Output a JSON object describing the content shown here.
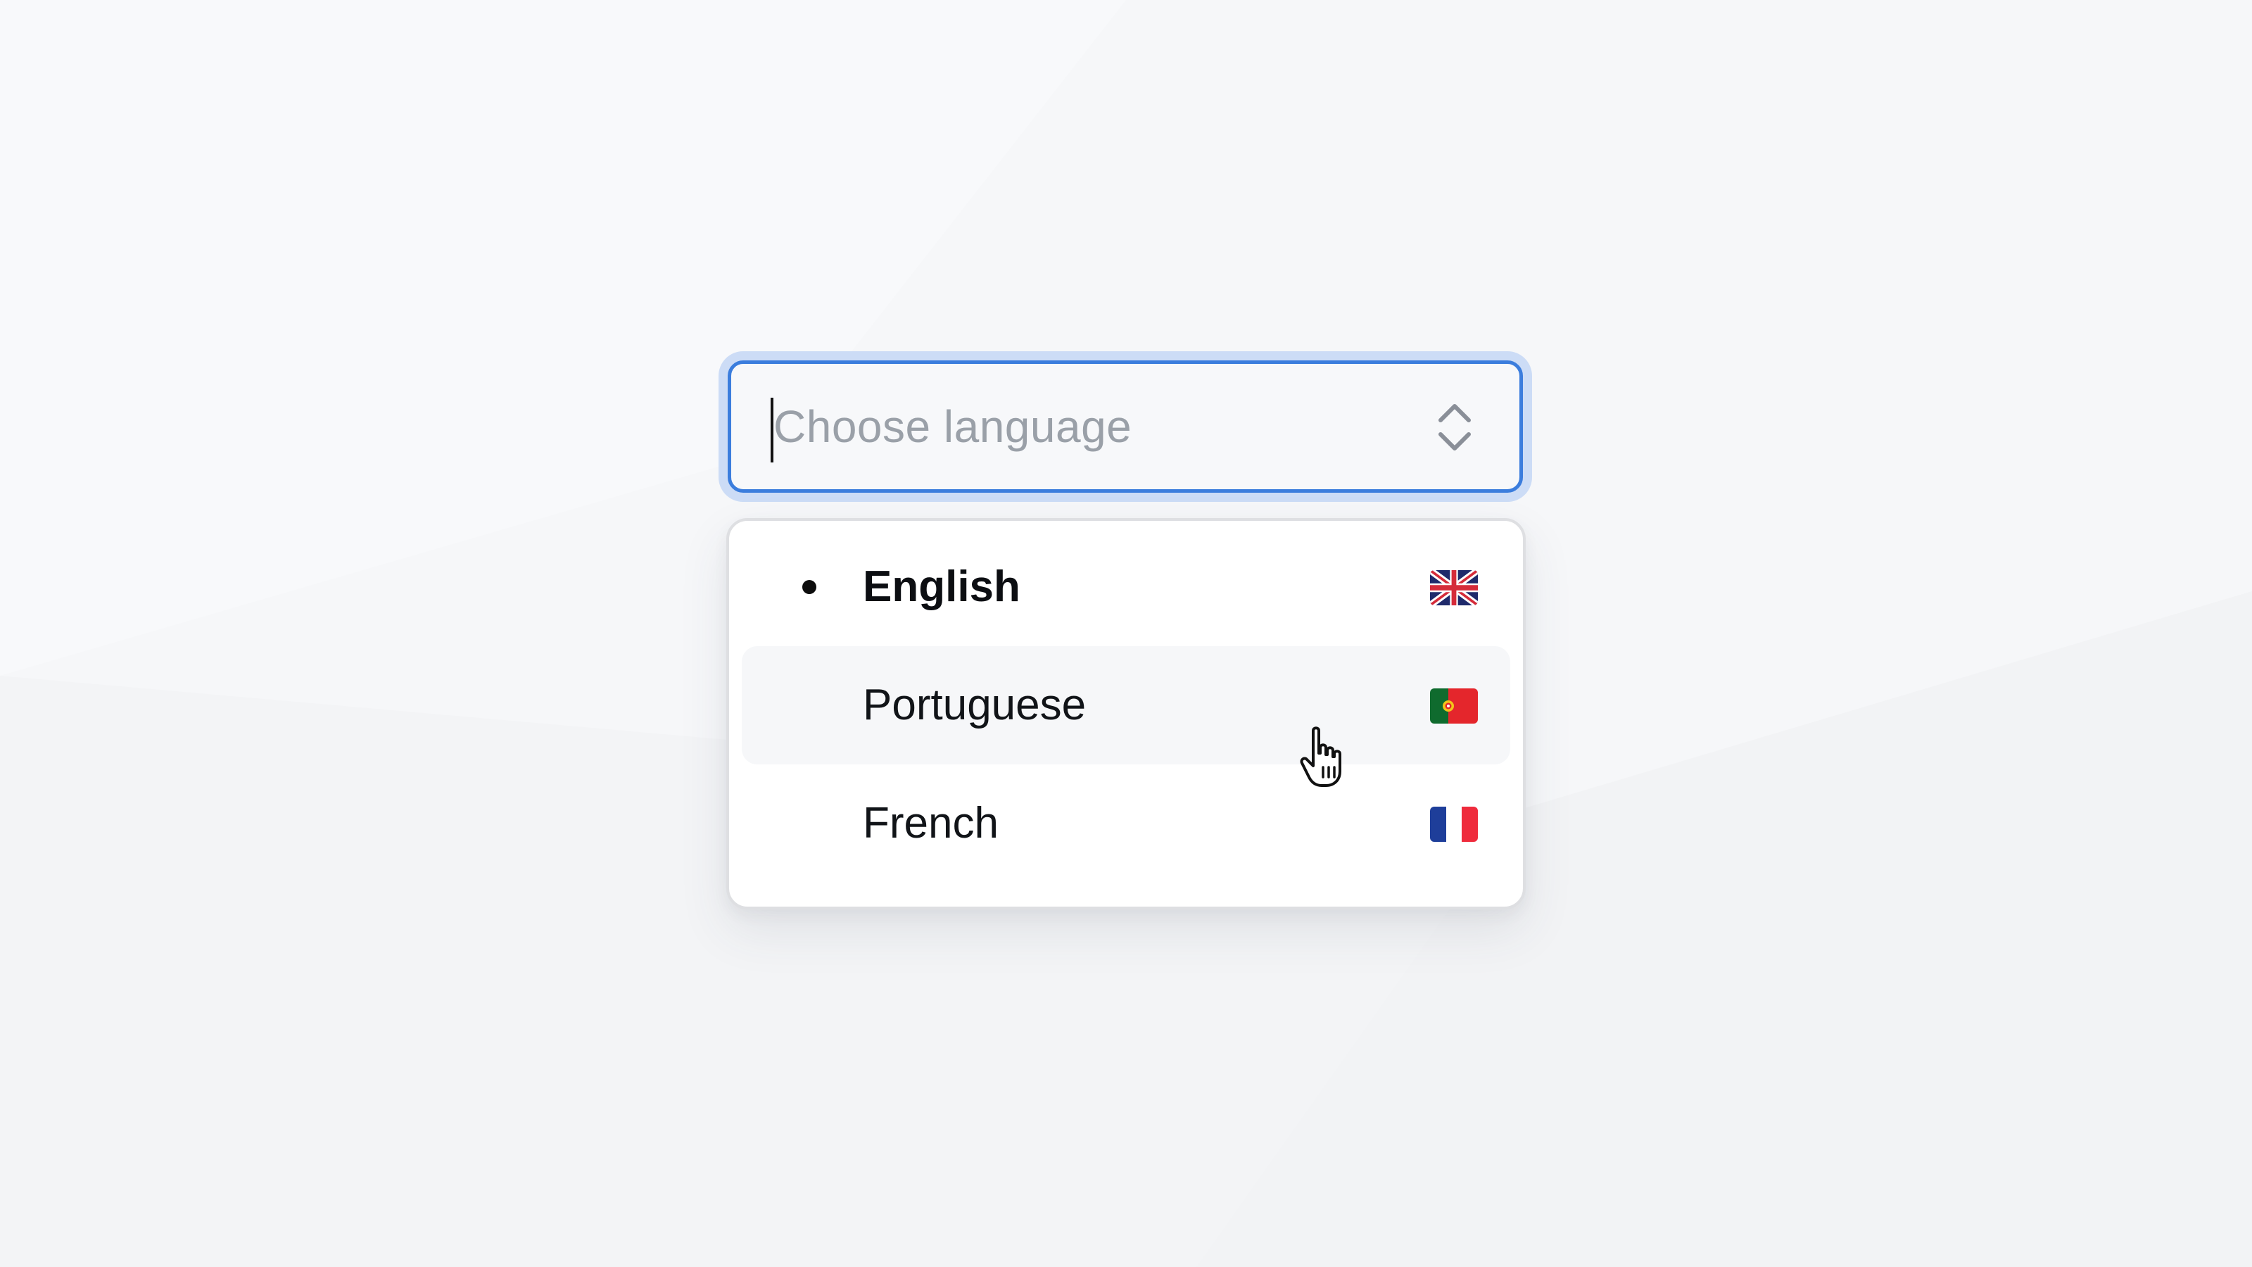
{
  "combobox": {
    "placeholder": "Choose language",
    "value": "",
    "toggle_icon": "chevron-up-down-icon",
    "focus_color": "#3b7ddd"
  },
  "options": [
    {
      "label": "English",
      "selected": true,
      "hovered": false,
      "flag": "uk-flag-icon"
    },
    {
      "label": "Portuguese",
      "selected": false,
      "hovered": true,
      "flag": "portugal-flag-icon"
    },
    {
      "label": "French",
      "selected": false,
      "hovered": false,
      "flag": "france-flag-icon"
    }
  ],
  "pointer": "hand-pointer-cursor-icon"
}
